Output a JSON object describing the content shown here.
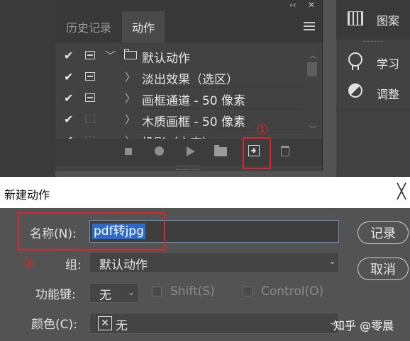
{
  "panel": {
    "header_icons": [
      "collapse-icon",
      "close-icon"
    ],
    "header_glyphs": {
      "collapse": "‹‹",
      "close": "✕"
    },
    "tabs": [
      {
        "label": "历史记录",
        "active": false
      },
      {
        "label": "动作",
        "active": true
      }
    ],
    "actions": [
      {
        "checked": true,
        "dialog": true,
        "label": "默认动作",
        "expanded": true,
        "is_set": true,
        "glyph": "﹀"
      },
      {
        "checked": true,
        "dialog": true,
        "label": "淡出效果（选区）",
        "glyph": "〉"
      },
      {
        "checked": true,
        "dialog": true,
        "label": "画框通道 - 50 像素",
        "glyph": "〉"
      },
      {
        "checked": true,
        "dialog": false,
        "label": "木质画框 - 50 像素",
        "glyph": "〉"
      },
      {
        "checked": true,
        "dialog": false,
        "label": "投影（文字）",
        "glyph": "〉",
        "partial": true
      }
    ],
    "check_glyph": "✔",
    "toolbar": [
      "stop-icon",
      "record-icon",
      "play-icon",
      "new-set-icon",
      "new-action-icon",
      "delete-icon"
    ],
    "annotation_1": "①"
  },
  "dock": {
    "items": [
      {
        "label": "图案",
        "icon": "pattern-icon"
      },
      {
        "label": "学习",
        "icon": "learn-icon"
      },
      {
        "label": "调整",
        "icon": "adjustments-icon"
      }
    ]
  },
  "dialog": {
    "title": "新建动作",
    "close_glyph": "╳",
    "name_label": "名称(N):",
    "name_value": "pdf转jpg",
    "group_label": "组:",
    "group_value": "默认动作",
    "fkey_label": "功能键:",
    "fkey_value": "无",
    "shift_label": "Shift(S)",
    "control_label": "Control(O)",
    "color_label": "颜色(C):",
    "color_value": "无",
    "color_x": "✕",
    "caret": "⌄",
    "record_button": "记录",
    "cancel_button": "取消",
    "annotation_2": "②"
  },
  "watermark": "知乎 @零晨",
  "colors": {
    "highlight": "#e0242b",
    "selection": "#2d6ac9"
  }
}
